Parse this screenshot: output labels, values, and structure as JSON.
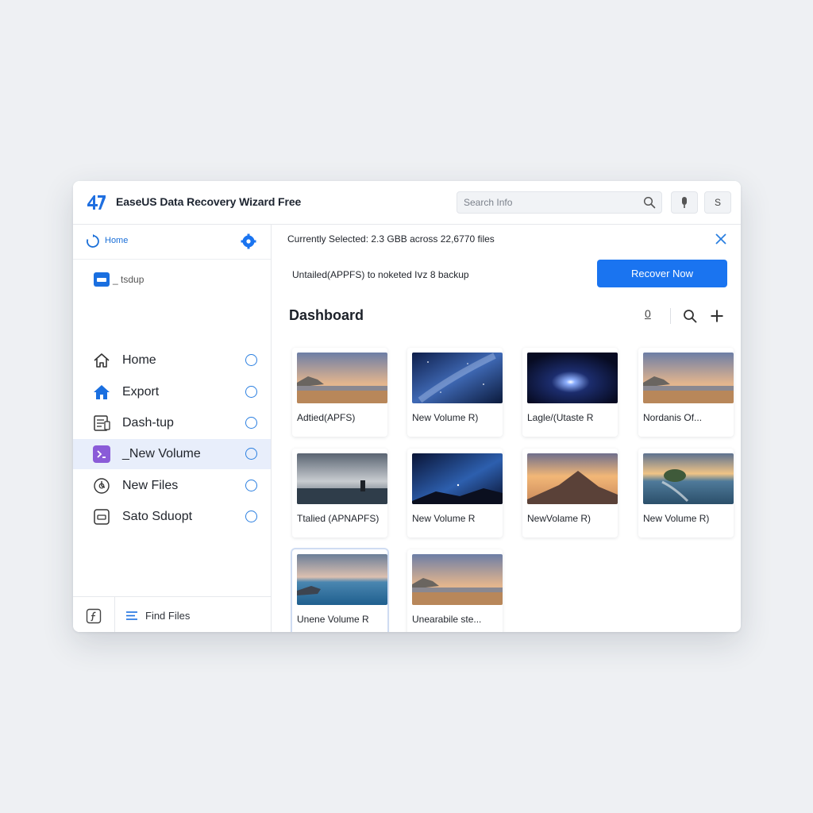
{
  "app": {
    "title": "EaseUS Data Recovery Wizard Free",
    "logo_text": "47"
  },
  "search": {
    "placeholder": "Search Info"
  },
  "toolbar": {
    "s_label": "S"
  },
  "sidebar": {
    "home_label": "Home",
    "sub_label": "_ tsdup",
    "items": [
      {
        "label": "Home",
        "icon": "house-outline-icon",
        "active": false
      },
      {
        "label": "Export",
        "icon": "house-filled-icon",
        "active": false
      },
      {
        "label": "Dash-tup",
        "icon": "document-list-icon",
        "active": false
      },
      {
        "label": "_New Volume",
        "icon": "purple-volume-icon",
        "active": true
      },
      {
        "label": "New Files",
        "icon": "clock-icon",
        "active": false
      },
      {
        "label": "Sato Sduopt",
        "icon": "drive-icon",
        "active": false
      }
    ],
    "footer": {
      "find_label": "Find Files"
    }
  },
  "status": {
    "text": "Currently Selected: 2.3 GBB across 22,6770 files"
  },
  "notice": {
    "text": "Untailed(APPFS) to noketed Iⅴz 8 backup"
  },
  "actions": {
    "recover_label": "Recover Now"
  },
  "dashboard": {
    "title": "Dashboard",
    "o_label": "0",
    "cards": [
      {
        "label": "Adtied(APFS)",
        "thumb": "beach-sunset"
      },
      {
        "label": "New Volume R)",
        "thumb": "milky-way"
      },
      {
        "label": "Lagle/(Utaste R",
        "thumb": "starburst"
      },
      {
        "label": "Nordanis Of...",
        "thumb": "beach-sunset"
      },
      {
        "label": "Ttalied (APNAPFS)",
        "thumb": "cloudy-sea"
      },
      {
        "label": "New Volume R",
        "thumb": "night-sky"
      },
      {
        "label": "NewVolame R)",
        "thumb": "mountain-sunset"
      },
      {
        "label": "New Volume R)",
        "thumb": "coast-sunset"
      },
      {
        "label": "Unene Volume R",
        "thumb": "lake-shore",
        "selected": true
      },
      {
        "label": "Unearabile ste...",
        "thumb": "beach-sunset"
      }
    ]
  },
  "colors": {
    "accent": "#1a74f0",
    "active_bg": "#e8eefb",
    "window_bg": "#ffffff",
    "page_bg": "#eef0f3"
  }
}
